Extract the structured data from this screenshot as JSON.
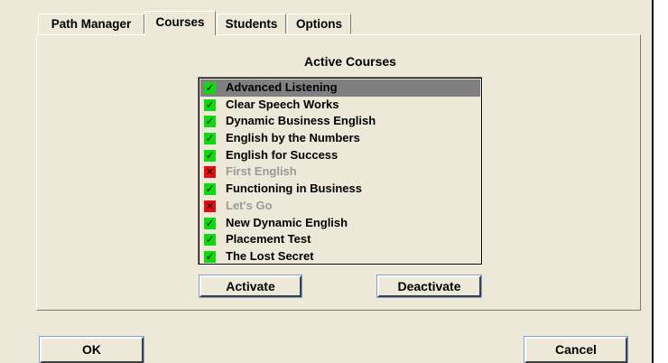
{
  "tabs": [
    {
      "label": "Path Manager"
    },
    {
      "label": "Courses"
    },
    {
      "label": "Students"
    },
    {
      "label": "Options"
    }
  ],
  "active_tab": "Courses",
  "panel": {
    "title": "Active Courses",
    "courses": [
      {
        "label": "Advanced Listening",
        "active": true,
        "selected": true
      },
      {
        "label": "Clear Speech Works",
        "active": true
      },
      {
        "label": "Dynamic Business English",
        "active": true
      },
      {
        "label": "English by the Numbers",
        "active": true
      },
      {
        "label": "English for Success",
        "active": true
      },
      {
        "label": "First English",
        "active": false
      },
      {
        "label": "Functioning in Business",
        "active": true
      },
      {
        "label": "Let's Go",
        "active": false
      },
      {
        "label": "New Dynamic English",
        "active": true
      },
      {
        "label": "Placement Test",
        "active": true
      },
      {
        "label": "The Lost Secret",
        "active": true
      }
    ],
    "activate_label": "Activate",
    "deactivate_label": "Deactivate"
  },
  "footer": {
    "ok_label": "OK",
    "cancel_label": "Cancel"
  },
  "colors": {
    "dialog_bg": "#ece9d8",
    "check_green": "#11d911",
    "cross_red": "#e01010",
    "selection_gray": "#808080",
    "inactive_text": "#9a9a9a"
  },
  "icons": {
    "active": "checkmark-icon",
    "inactive": "cross-icon"
  }
}
